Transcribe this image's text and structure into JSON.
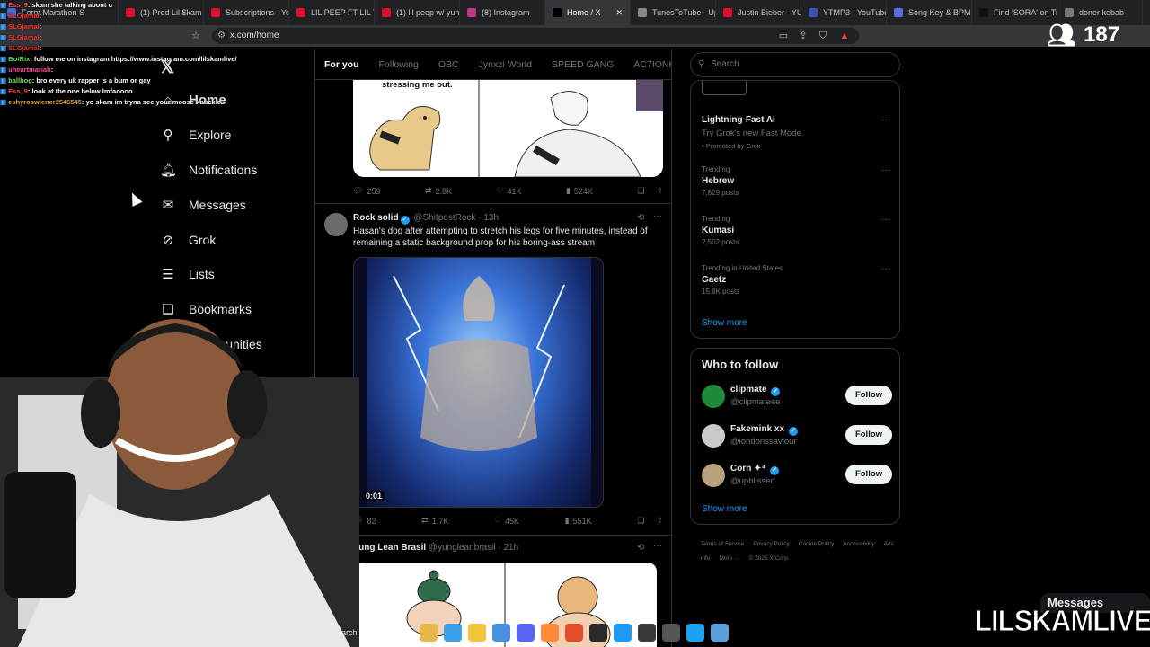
{
  "browser": {
    "tabs": [
      {
        "label": "Form Marathon S",
        "color": "#3c6ee0"
      },
      {
        "label": "(1) Prod Lil $kam",
        "color": "#e00d2d"
      },
      {
        "label": "Subscriptions - Yo",
        "color": "#e00d2d"
      },
      {
        "label": "LIL PEEP FT LIL TR",
        "color": "#e00d2d"
      },
      {
        "label": "(1) lil peep w/ yun",
        "color": "#e00d2d"
      },
      {
        "label": "(8) Instagram",
        "color": "#c13584"
      },
      {
        "label": "Home / X",
        "color": "#000000",
        "active": true
      },
      {
        "label": "TunesToTube - Up",
        "color": "#888888"
      },
      {
        "label": "Justin Bieber - YU",
        "color": "#e00d2d"
      },
      {
        "label": "YTMP3 - YouTube",
        "color": "#3f51b5"
      },
      {
        "label": "Song Key & BPM",
        "color": "#5b6ee1"
      },
      {
        "label": "Find 'SORA' on Tik",
        "color": "#111111"
      },
      {
        "label": "doner kebab",
        "color": "#777777"
      }
    ],
    "url": "x.com/home"
  },
  "stream": {
    "viewer_count": "187",
    "brand": "LILSKAMLIVE",
    "messages_label": "Messages",
    "chat": [
      {
        "user": "Ess_9",
        "text": ": skam she talking about u",
        "color": "#ff4a4a"
      },
      {
        "user": "SLGjamal",
        "text": ":",
        "color": "#ff3030"
      },
      {
        "user": "SLGjamal",
        "text": ":",
        "color": "#ff3030"
      },
      {
        "user": "SLGjamal",
        "text": ":",
        "color": "#ff3030"
      },
      {
        "user": "SLGjamal",
        "text": ":",
        "color": "#ff3030"
      },
      {
        "user": "BotRix",
        "text": ": follow me on instagram https://www.instagram.com/lilskamlive/",
        "color": "#5bd65b"
      },
      {
        "user": "uheartmariah",
        "text": ":",
        "color": "#ff4aa0"
      },
      {
        "user": "ballhog",
        "text": ": bro every uk rapper is a bum or gay",
        "color": "#7ddc5b"
      },
      {
        "user": "Ess_9",
        "text": ": look at the one below lmfaoooo",
        "color": "#ff4a4a"
      },
      {
        "user": "eshyroswiener2546545",
        "text": ": yo skam im tryna see your moose knuckle",
        "color": "#d9a03a"
      }
    ]
  },
  "nav": {
    "items": [
      {
        "label": "Home",
        "icon": "home-icon",
        "glyph": "⌂"
      },
      {
        "label": "Explore",
        "icon": "search-icon",
        "glyph": "⚲"
      },
      {
        "label": "Notifications",
        "icon": "bell-icon",
        "glyph": "🔔︎"
      },
      {
        "label": "Messages",
        "icon": "mail-icon",
        "glyph": "✉"
      },
      {
        "label": "Grok",
        "icon": "grok-icon",
        "glyph": "⊘"
      },
      {
        "label": "Lists",
        "icon": "list-icon",
        "glyph": "☰"
      },
      {
        "label": "Bookmarks",
        "icon": "bookmark-icon",
        "glyph": "❏"
      },
      {
        "label": "Communities",
        "icon": "communities-icon",
        "glyph": "☺"
      }
    ]
  },
  "timeline": {
    "tabs": [
      "For you",
      "Following",
      "OBC",
      "Jynxzi World",
      "SPEED GANG",
      "AC7IONHOU"
    ],
    "post1": {
      "image_caption": "stressing me out.",
      "replies": "259",
      "reposts": "2.8K",
      "likes": "41K",
      "views": "524K"
    },
    "post2": {
      "name": "Rock solid",
      "handle": "@ShitpostRock",
      "time": "· 13h",
      "text": "Hasan's dog after attempting to stretch his legs for five minutes, instead of remaining a static background prop for his boring-ass stream",
      "video_time": "0:01",
      "replies": "82",
      "reposts": "1.7K",
      "likes": "45K",
      "views": "551K"
    },
    "post3": {
      "name": "Yung Lean Brasil",
      "handle": "@yungleanbrasil",
      "time": "· 21h"
    }
  },
  "sidebar": {
    "search_placeholder": "Search",
    "promoted": {
      "title": "Lightning-Fast AI",
      "subtitle": "Try Grok's new Fast Mode.",
      "promoted_by": "Promoted by Grok"
    },
    "trends": [
      {
        "context": "Trending",
        "name": "Hebrew",
        "count": "7,829 posts"
      },
      {
        "context": "Trending",
        "name": "Kumasi",
        "count": "2,502 posts"
      },
      {
        "context": "Trending in United States",
        "name": "Gaetz",
        "count": "15.8K posts"
      }
    ],
    "show_more": "Show more",
    "who_to_follow": {
      "title": "Who to follow",
      "accounts": [
        {
          "name": "clipmate",
          "handle": "@clipmateee",
          "avatar_color": "#1f8a3a"
        },
        {
          "name": "Fakemink xx",
          "handle": "@londonssaviour",
          "avatar_color": "#c9c9c9"
        },
        {
          "name": "Corn ✦⁴",
          "handle": "@upblissed",
          "avatar_color": "#b9a27a"
        }
      ],
      "follow_label": "Follow",
      "show_more": "Show more"
    },
    "footer": [
      "Terms of Service",
      "Privacy Policy",
      "Cookie Policy",
      "Accessibility",
      "Ads info",
      "More ···",
      "© 2025 X Corp."
    ]
  },
  "taskbar": {
    "search_label": "arch",
    "icons": [
      "#e6b84a",
      "#3aa0e8",
      "#f3c33a",
      "#4a90e2",
      "#5865f2",
      "#ff8a3a",
      "#e44d26",
      "#2a2a2a",
      "#1b9cfc",
      "#3a3a3a",
      "#555555",
      "#1da1f2",
      "#5aa0d8"
    ]
  }
}
